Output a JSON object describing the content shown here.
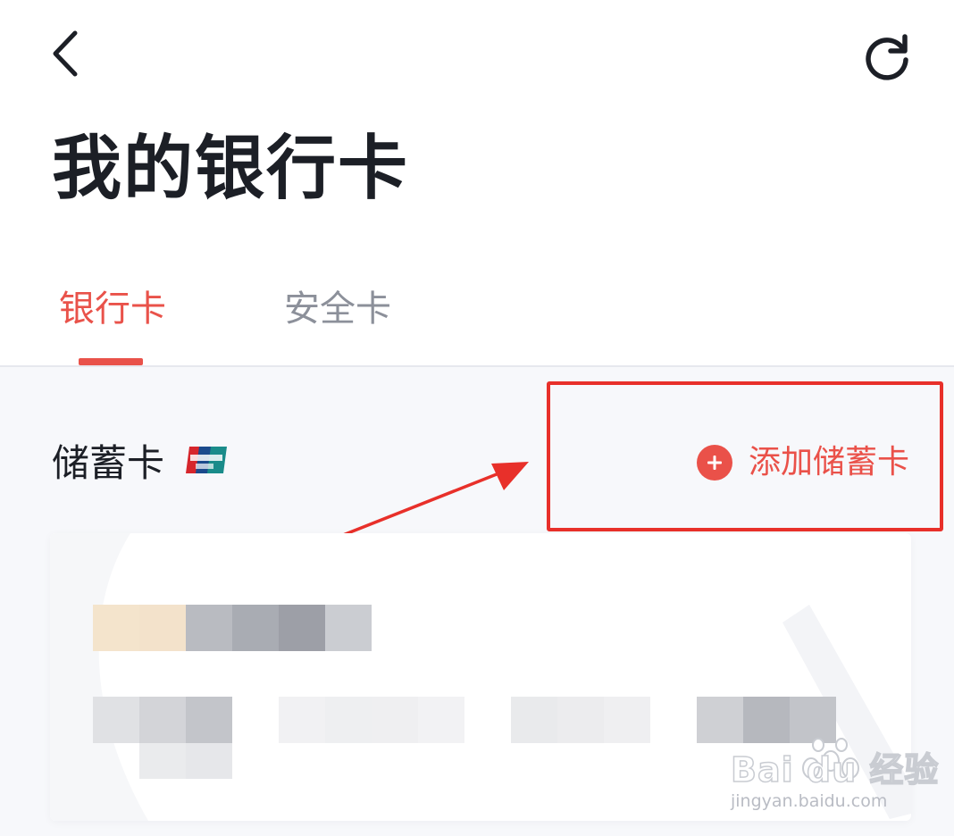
{
  "header": {
    "back_icon": "chevron-left-icon",
    "refresh_icon": "refresh-icon",
    "title": "我的银行卡"
  },
  "tabs": [
    {
      "label": "银行卡",
      "active": true
    },
    {
      "label": "安全卡",
      "active": false
    }
  ],
  "debit_section": {
    "title": "储蓄卡",
    "brand_icon": "unionpay-icon",
    "add_button_label": "添加储蓄卡",
    "add_icon": "plus-circle-icon"
  },
  "watermark": {
    "brand": "Bai du 经验",
    "url": "jingyan.baidu.com"
  },
  "colors": {
    "accent": "#e9524a",
    "annotation": "#e8302a",
    "title": "#1c1f26",
    "inactive_tab": "#8c909a",
    "content_bg": "#f7f8fb"
  }
}
